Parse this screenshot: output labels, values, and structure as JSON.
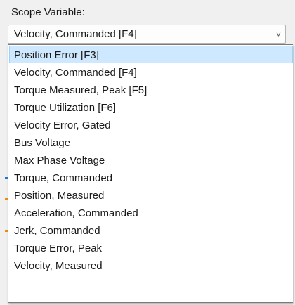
{
  "scope": {
    "label": "Scope Variable:",
    "selected_value": "Velocity, Commanded [F4]",
    "arrow_icon": "chevron-down-icon",
    "arrow_glyph": "˅"
  },
  "dropdown": {
    "highlighted_index": 0,
    "items": [
      "Position Error [F3]",
      "Velocity, Commanded [F4]",
      "Torque Measured, Peak [F5]",
      "Torque Utilization [F6]",
      "Velocity Error, Gated",
      "Bus Voltage",
      "Max Phase Voltage",
      "Torque, Commanded",
      "Position, Measured",
      "Acceleration, Commanded",
      "Jerk, Commanded",
      "Torque Error, Peak",
      "Velocity, Measured"
    ]
  },
  "colors": {
    "highlight_bg": "#cde8ff",
    "highlight_border": "#99d1ff",
    "marker_blue": "#1f77d0",
    "marker_orange": "#e88a1a"
  }
}
